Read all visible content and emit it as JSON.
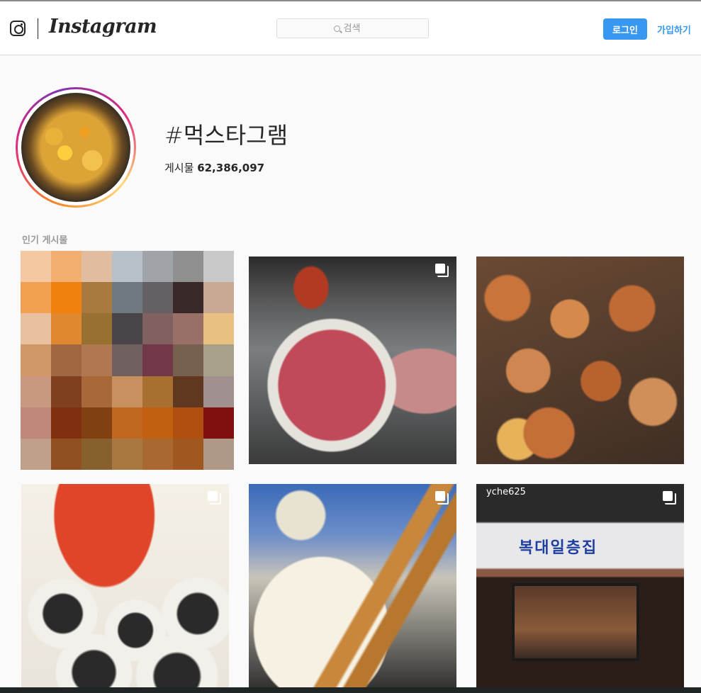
{
  "header": {
    "logo_text": "Instagram",
    "search_placeholder": "검색",
    "login_label": "로그인",
    "signup_label": "가입하기"
  },
  "profile": {
    "hashtag": "#먹스타그램",
    "posts_label": "게시물",
    "posts_count": "62,386,097"
  },
  "section": {
    "top_posts_label": "인기 게시물"
  },
  "tiles": {
    "t6_sign": "복대일층집",
    "t6_tag": "yche625"
  },
  "pixel_colors": [
    "#f4c8a0",
    "#f2b070",
    "#e0bca0",
    "#b8c0c8",
    "#a0a4a8",
    "#909090",
    "#c8c8c8",
    "#f0a050",
    "#f08010",
    "#a87a40",
    "#707880",
    "#646064",
    "#382828",
    "#c8a890",
    "#e8c0a0",
    "#e08830",
    "#987030",
    "#484448",
    "#806060",
    "#987068",
    "#e8c080",
    "#d09868",
    "#a06840",
    "#b07850",
    "#706060",
    "#703848",
    "#786050",
    "#a8a088",
    "#c89880",
    "#804020",
    "#a86838",
    "#c89060",
    "#a87030",
    "#603820",
    "#a09090",
    "#c08878",
    "#803010",
    "#804010",
    "#c06820",
    "#c06010",
    "#b05010",
    "#801010",
    "#c0a088",
    "#905020",
    "#886030",
    "#a87840",
    "#a86830",
    "#a05820",
    "#b09888"
  ],
  "colors": {
    "accent": "#3897f0",
    "text": "#262626",
    "muted": "#999999",
    "background": "#fafafa"
  }
}
